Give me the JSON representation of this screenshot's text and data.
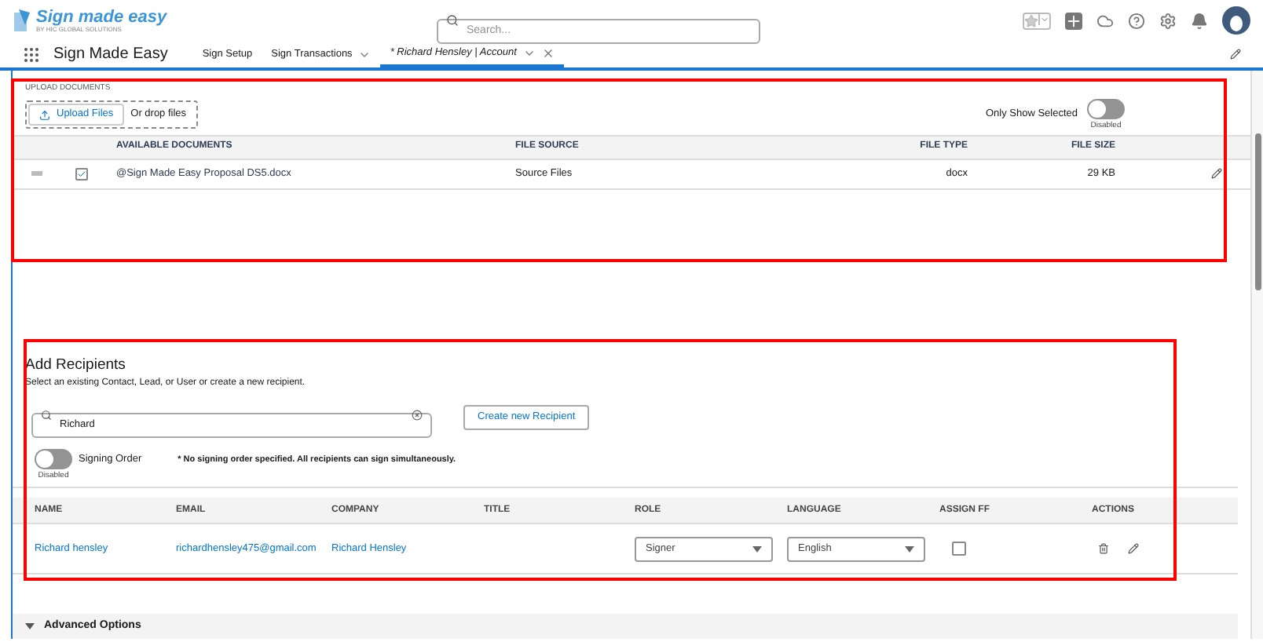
{
  "header": {
    "logo_title": "Sign made easy",
    "logo_subtitle": "BY HIC GLOBAL SOLUTIONS",
    "search_placeholder": "Search...",
    "app_name": "Sign Made Easy"
  },
  "nav_tabs": [
    {
      "label": "Sign Setup",
      "selected": false,
      "kind": "plain"
    },
    {
      "label": "Sign Transactions",
      "selected": false,
      "kind": "menu"
    },
    {
      "label": "* Richard Hensley | Account",
      "selected": true,
      "kind": "record"
    }
  ],
  "upload": {
    "section_label": "UPLOAD DOCUMENTS",
    "upload_button": "Upload Files",
    "drop_text": "Or drop files",
    "toggle_label": "Only Show Selected",
    "toggle_on": false,
    "toggle_state": "Disabled",
    "columns": [
      "AVAILABLE DOCUMENTS",
      "FILE SOURCE",
      "FILE TYPE",
      "FILE SIZE"
    ],
    "rows": [
      {
        "checked": true,
        "name": "@Sign Made Easy Proposal DS5.docx",
        "source": "Source Files",
        "type": "docx",
        "size": "29 KB"
      }
    ]
  },
  "recipients": {
    "title": "Add Recipients",
    "subtitle": "Select an existing Contact, Lead, or User or create a new recipient.",
    "search_value": "Richard",
    "create_button": "Create new Recipient",
    "toggle_label": "Signing Order",
    "toggle_on": false,
    "toggle_state": "Disabled",
    "note": "* No signing order specified. All recipients can sign simultaneously.",
    "columns": [
      "NAME",
      "EMAIL",
      "COMPANY",
      "TITLE",
      "ROLE",
      "LANGUAGE",
      "ASSIGN FF",
      "ACTIONS"
    ],
    "rows": [
      {
        "name": "Richard hensley",
        "email": "richardhensley475@gmail.com",
        "company": "Richard Hensley",
        "role": "Signer",
        "language": "English",
        "assign_ff": false
      }
    ]
  },
  "advanced": {
    "label": "Advanced Options",
    "expanded": false
  }
}
